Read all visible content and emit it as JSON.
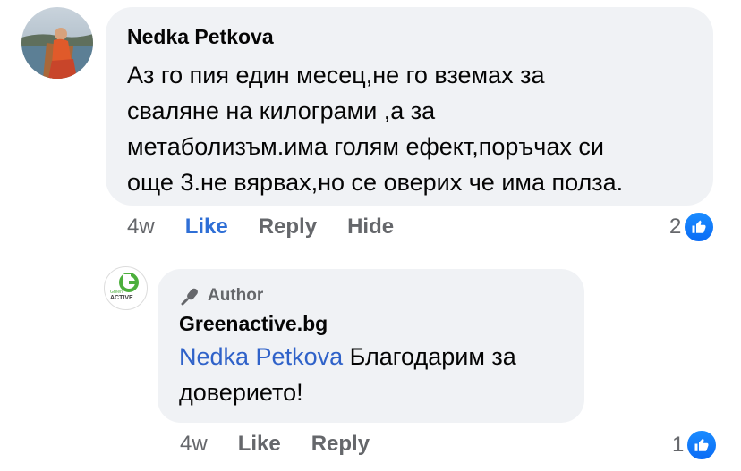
{
  "comment": {
    "author": "Nedka Petkova",
    "text": "Аз го пия един месец,не го вземах за сваляне на килограми ,а за метаболизъм.има голям ефект,поръчах си още 3.не вярвах,но се оверих че има полза.",
    "lines": [
      "Аз го пия един месец,не го вземах за",
      "сваляне на килограми ,а за",
      "метаболизъм.има голям ефект,поръчах си",
      "още 3.не вярвах,но се оверих че има полза."
    ],
    "time": "4w",
    "like_label": "Like",
    "reply_label": "Reply",
    "hide_label": "Hide",
    "reaction_count": "2"
  },
  "reply": {
    "badge_label": "Author",
    "author": "Greenactive.bg",
    "mention": "Nedka Petkova",
    "text_line1": " Благодарим за",
    "text_line2": "доверието!",
    "time": "4w",
    "like_label": "Like",
    "reply_label": "Reply",
    "reaction_count": "1",
    "logo_text": "ACTIVE",
    "logo_small": "Green"
  },
  "colors": {
    "bubble": "#f0f2f5",
    "link_blue": "#2f62c9",
    "like_active": "#2f6fd6",
    "meta_gray": "#65676b",
    "brand_green": "#4caf3c"
  },
  "icons": {
    "reaction": "thumbs-up-icon",
    "author_badge": "microphone-icon"
  }
}
